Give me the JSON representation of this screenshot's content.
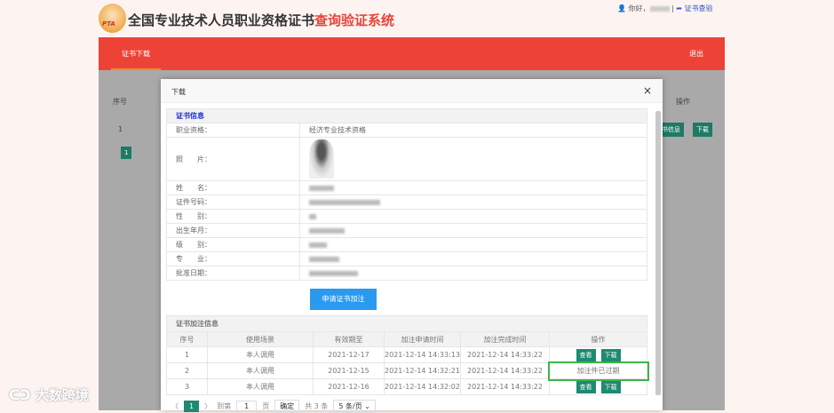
{
  "header": {
    "logo_text": "PTA",
    "title_main": "全国专业技术人员职业资格证书",
    "title_accent": "查询验证系统",
    "greeting": "你好，",
    "cert_check_link": "证书查验"
  },
  "nav": {
    "tab": "证书下载",
    "logout": "退出"
  },
  "background_table": {
    "col_index": "序号",
    "col_action": "操作",
    "row_index": "1",
    "btn_info": "书信息",
    "btn_download": "下载",
    "page": "1"
  },
  "modal": {
    "title": "下载",
    "close": "×",
    "cert_section": "证书信息",
    "fields": [
      {
        "label": "职业资格：",
        "value": "经济专业技术资格"
      },
      {
        "label": "照　　片："
      },
      {
        "label": "姓　　名："
      },
      {
        "label": "证件号码："
      },
      {
        "label": "性　　别："
      },
      {
        "label": "出生年月："
      },
      {
        "label": "级　　别："
      },
      {
        "label": "专　　业："
      },
      {
        "label": "批准日期："
      }
    ],
    "apply_button": "申请证书加注",
    "annotation_section": "证书加注信息",
    "columns": [
      "序号",
      "使用场景",
      "有效期至",
      "加注申请时间",
      "加注完成时间",
      "操作"
    ],
    "rows": [
      {
        "no": "1",
        "scene": "本人调用",
        "valid": "2021-12-17",
        "applied": "2021-12-14 14:33:13",
        "completed": "2021-12-14 14:33:22"
      },
      {
        "no": "2",
        "scene": "本人调用",
        "valid": "2021-12-15",
        "applied": "2021-12-14 14:32:21",
        "completed": "2021-12-14 14:33:22",
        "status": "加注件已过期"
      },
      {
        "no": "3",
        "scene": "本人调用",
        "valid": "2021-12-16",
        "applied": "2021-12-14 14:32:02",
        "completed": "2021-12-14 14:33:22"
      }
    ],
    "view_label": "查看",
    "download_label": "下载",
    "pager": {
      "prev": "〈",
      "current": "1",
      "next": "〉",
      "goto": "到第",
      "page_input": "1",
      "page_unit": "页",
      "confirm": "确定",
      "total": "共 3 条",
      "page_size": "5 条/页"
    }
  },
  "watermark": "大数跨境"
}
